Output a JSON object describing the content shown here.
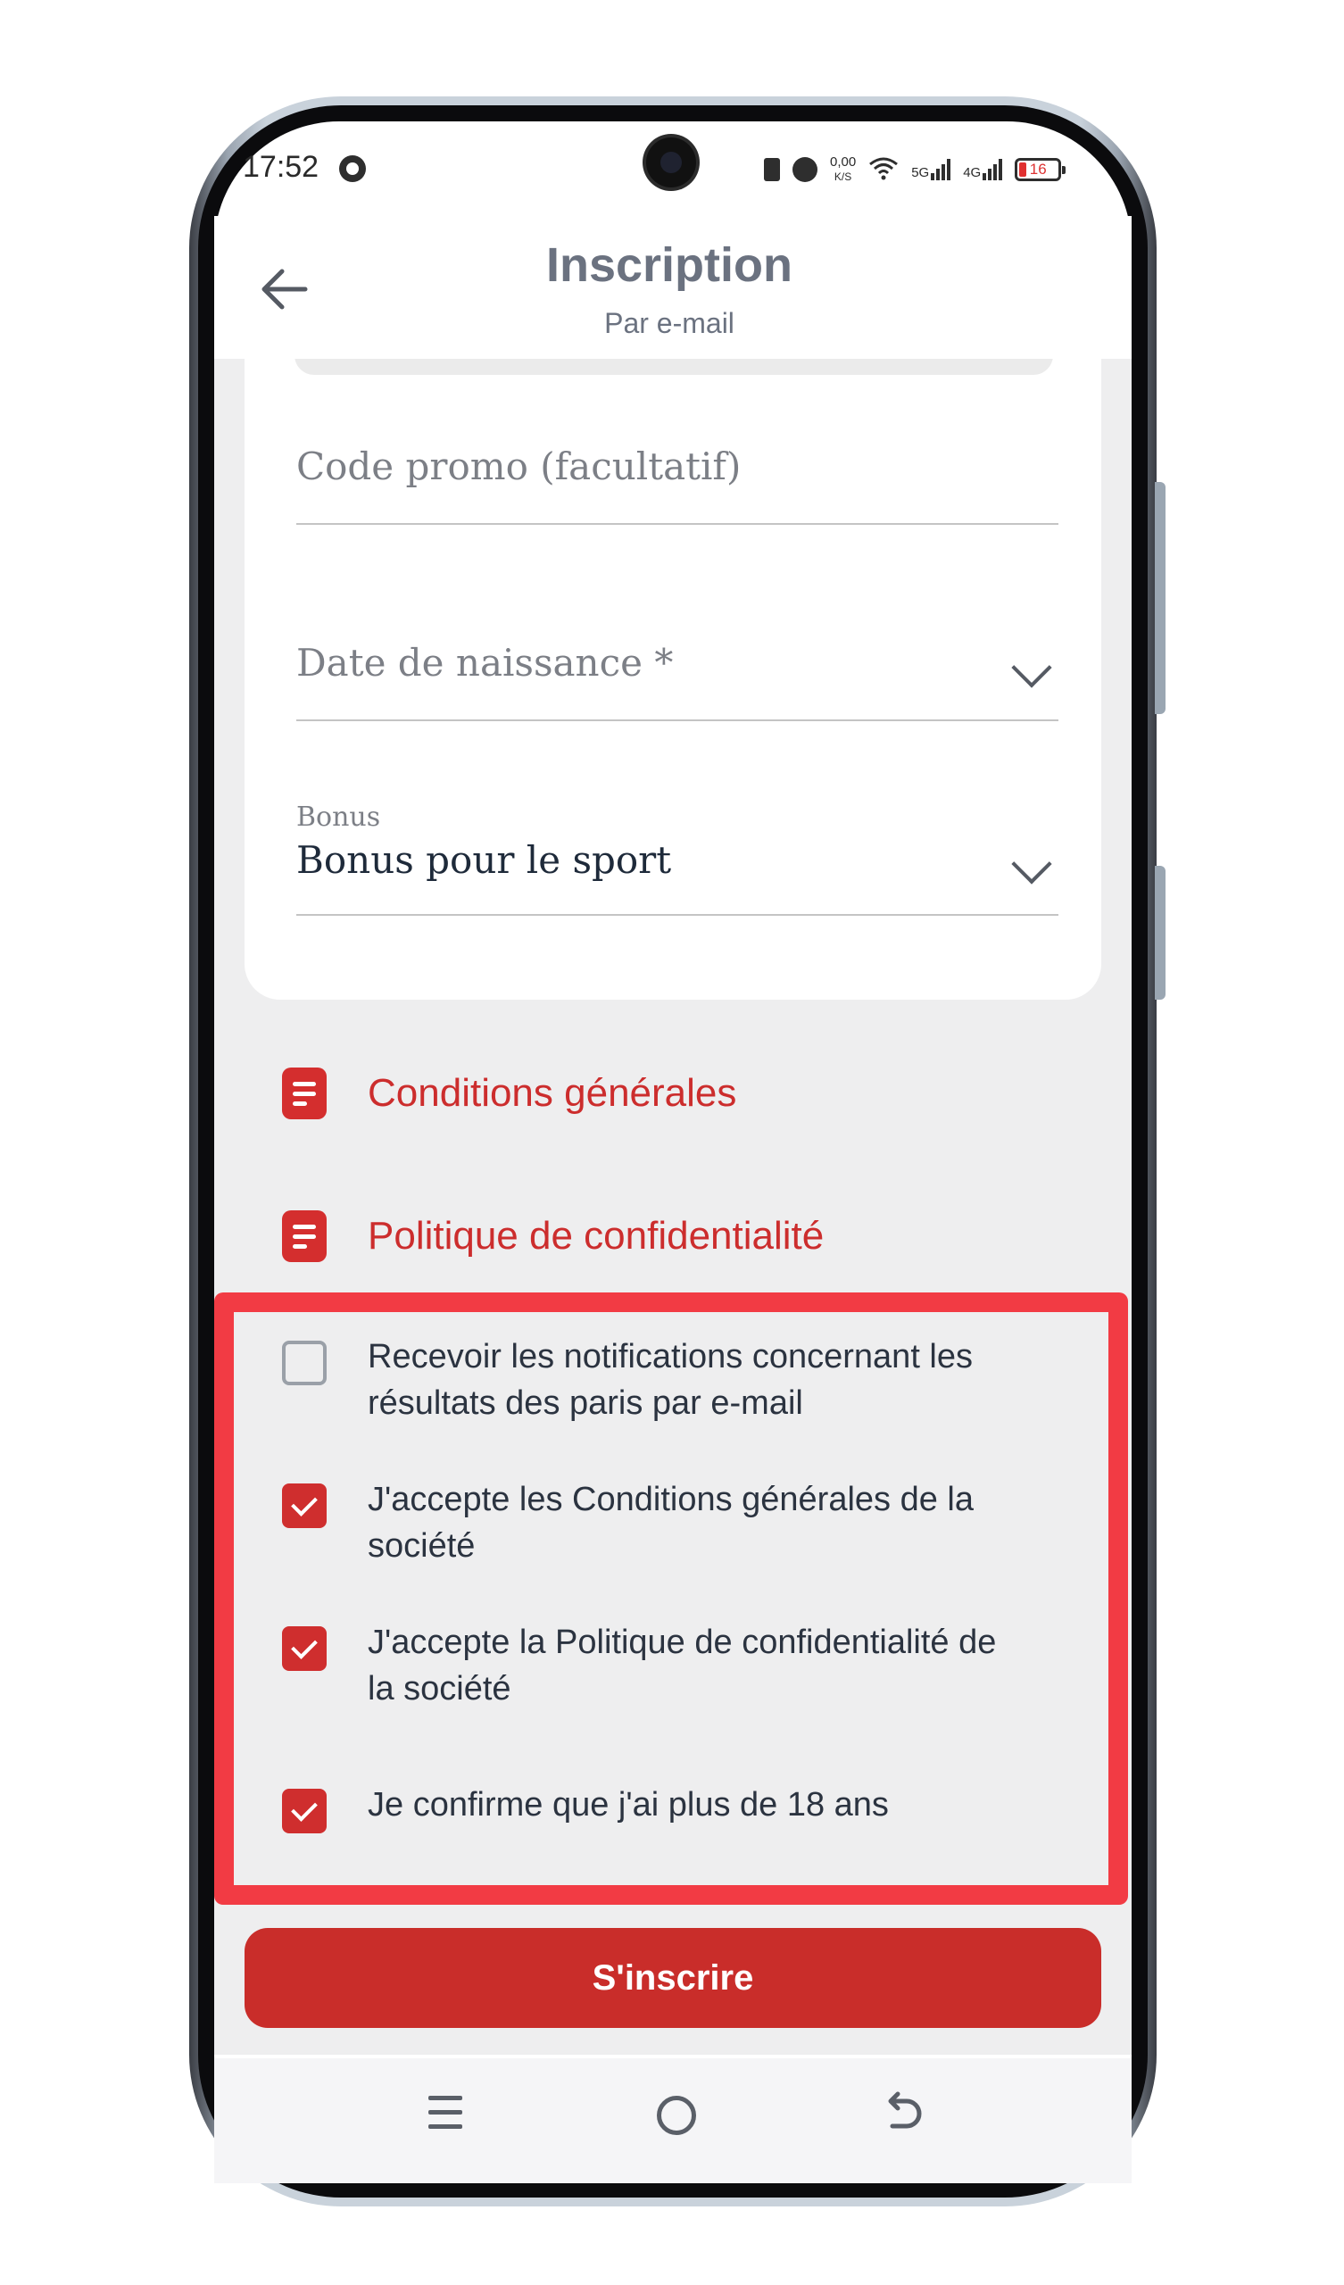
{
  "status_bar": {
    "time": "17:52",
    "network_speed": "0,00",
    "network_speed_unit": "K/S",
    "signal_1": "5G",
    "signal_2": "4G",
    "battery": "16",
    "icons": [
      "whatsapp-icon",
      "vibrate-icon",
      "alarm-icon",
      "wifi-icon",
      "signal-icon",
      "battery-icon"
    ]
  },
  "header": {
    "title": "Inscription",
    "subtitle": "Par e-mail",
    "back_icon": "arrow-left-icon"
  },
  "form": {
    "promo_placeholder": "Code promo (facultatif)",
    "birthdate_placeholder": "Date de naissance *",
    "bonus_label": "Bonus",
    "bonus_value": "Bonus pour le sport"
  },
  "links": [
    {
      "label": "Conditions générales",
      "icon": "document-icon"
    },
    {
      "label": "Politique de confidentialité",
      "icon": "document-icon"
    }
  ],
  "checkboxes": [
    {
      "label": "Recevoir les notifications concernant les résultats des paris par e-mail",
      "checked": false
    },
    {
      "label": "J'accepte les Conditions générales de la société",
      "checked": true
    },
    {
      "label": "J'accepte la Politique de confidentialité de la société",
      "checked": true
    },
    {
      "label": "Je confirme que j'ai plus de 18 ans",
      "checked": true
    }
  ],
  "submit_label": "S'inscrire",
  "colors": {
    "accent": "#c92d2a",
    "highlight": "#f23b44",
    "background": "#eeeeef"
  },
  "nav": {
    "icons": [
      "menu-icon",
      "home-icon",
      "back-icon"
    ]
  }
}
